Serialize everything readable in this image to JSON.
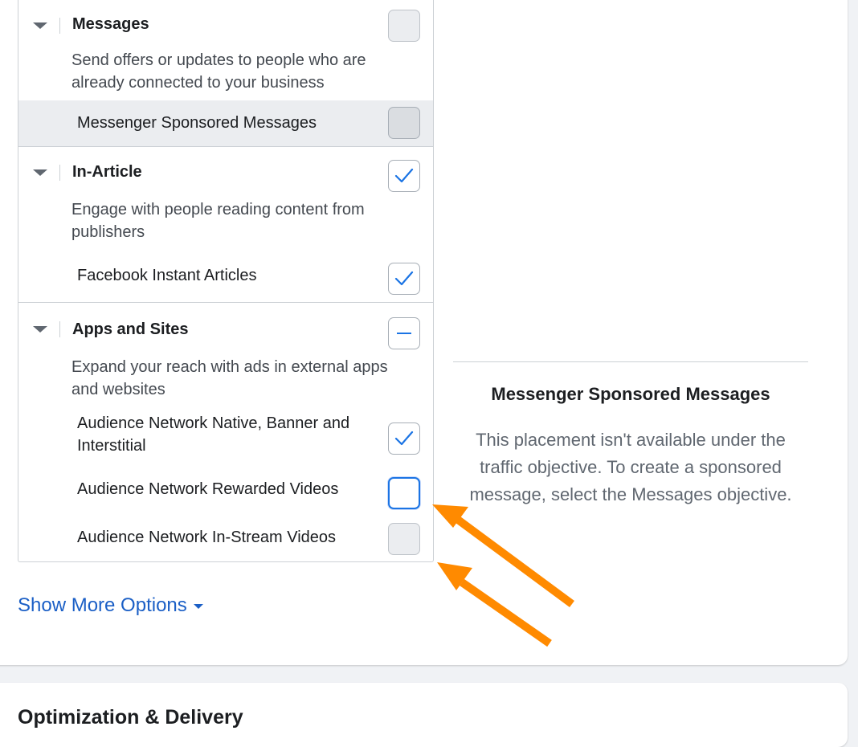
{
  "groups": [
    {
      "title": "Messages",
      "description": "Send offers or updates to people who are already connected to your business",
      "state": "disabled",
      "items": [
        {
          "label": "Messenger Sponsored Messages",
          "state": "disabled"
        }
      ]
    },
    {
      "title": "In-Article",
      "description": "Engage with people reading content from publishers",
      "state": "checked",
      "items": [
        {
          "label": "Facebook Instant Articles",
          "state": "checked"
        }
      ]
    },
    {
      "title": "Apps and Sites",
      "description": "Expand your reach with ads in external apps and websites",
      "state": "indeterminate",
      "items": [
        {
          "label": "Audience Network Native, Banner and Interstitial",
          "state": "checked"
        },
        {
          "label": "Audience Network Rewarded Videos",
          "state": "unchecked"
        },
        {
          "label": "Audience Network In-Stream Videos",
          "state": "disabled"
        }
      ]
    }
  ],
  "info_panel": {
    "title": "Messenger Sponsored Messages",
    "text": "This placement isn't available under the traffic objective. To create a sponsored message, select the Messages objective."
  },
  "show_more_label": "Show More Options",
  "next_section_title": "Optimization & Delivery",
  "colors": {
    "accent": "#1b74e4",
    "link": "#1b5fc6",
    "annotation_arrow": "#ff8a00"
  },
  "icons": {
    "check": "checkmark-icon",
    "indeterminate": "minus-icon",
    "caret": "caret-down-icon"
  }
}
